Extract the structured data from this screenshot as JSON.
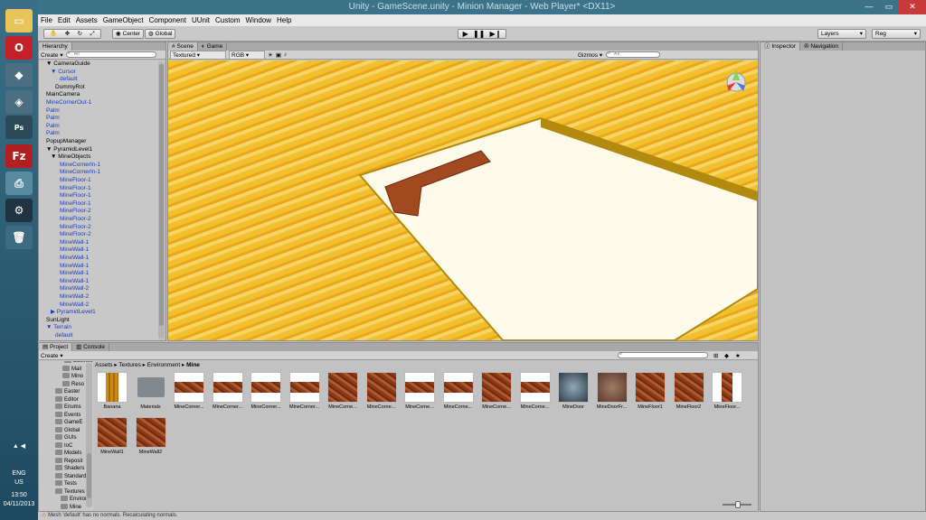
{
  "window": {
    "title": "Unity - GameScene.unity - Minion Manager - Web Player* <DX11>"
  },
  "menu": [
    "File",
    "Edit",
    "Assets",
    "GameObject",
    "Component",
    "UUnit",
    "Custom",
    "Window",
    "Help"
  ],
  "toolbar": {
    "center_label": "Center",
    "global_label": "Global",
    "layers_label": "Layers",
    "layout_label": "Reg"
  },
  "hierarchy": {
    "tab": "Hierarchy",
    "create": "Create",
    "search_placeholder": "All",
    "items": [
      {
        "text": "▼ CameraGuide",
        "indent": 0,
        "blue": false
      },
      {
        "text": "▼ Cursor",
        "indent": 1,
        "blue": true
      },
      {
        "text": "default",
        "indent": 3,
        "blue": true
      },
      {
        "text": "DummyRot",
        "indent": 2,
        "blue": false
      },
      {
        "text": "MainCamera",
        "indent": 0,
        "blue": false
      },
      {
        "text": "MineCornerOut-1",
        "indent": 0,
        "blue": true
      },
      {
        "text": "Palm",
        "indent": 0,
        "blue": true
      },
      {
        "text": "Palm",
        "indent": 0,
        "blue": true
      },
      {
        "text": "Palm",
        "indent": 0,
        "blue": true
      },
      {
        "text": "Palm",
        "indent": 0,
        "blue": true
      },
      {
        "text": "PopupManager",
        "indent": 0,
        "blue": false
      },
      {
        "text": "▼ PyramidLevel1",
        "indent": 0,
        "blue": false
      },
      {
        "text": "▼ MineObjects",
        "indent": 1,
        "blue": false
      },
      {
        "text": "MineCornerIn-1",
        "indent": 3,
        "blue": true
      },
      {
        "text": "MineCornerIn-1",
        "indent": 3,
        "blue": true
      },
      {
        "text": "MineFloor-1",
        "indent": 3,
        "blue": true
      },
      {
        "text": "MineFloor-1",
        "indent": 3,
        "blue": true
      },
      {
        "text": "MineFloor-1",
        "indent": 3,
        "blue": true
      },
      {
        "text": "MineFloor-1",
        "indent": 3,
        "blue": true
      },
      {
        "text": "MineFloor-2",
        "indent": 3,
        "blue": true
      },
      {
        "text": "MineFloor-2",
        "indent": 3,
        "blue": true
      },
      {
        "text": "MineFloor-2",
        "indent": 3,
        "blue": true
      },
      {
        "text": "MineFloor-2",
        "indent": 3,
        "blue": true
      },
      {
        "text": "MineWall-1",
        "indent": 3,
        "blue": true
      },
      {
        "text": "MineWall-1",
        "indent": 3,
        "blue": true
      },
      {
        "text": "MineWall-1",
        "indent": 3,
        "blue": true
      },
      {
        "text": "MineWall-1",
        "indent": 3,
        "blue": true
      },
      {
        "text": "MineWall-1",
        "indent": 3,
        "blue": true
      },
      {
        "text": "MineWall-1",
        "indent": 3,
        "blue": true
      },
      {
        "text": "MineWall-2",
        "indent": 3,
        "blue": true
      },
      {
        "text": "MineWall-2",
        "indent": 3,
        "blue": true
      },
      {
        "text": "MineWall-2",
        "indent": 3,
        "blue": true
      },
      {
        "text": "▶ PyramidLevel1",
        "indent": 1,
        "blue": true
      },
      {
        "text": "SunLight",
        "indent": 0,
        "blue": false
      },
      {
        "text": "▼ Terrain",
        "indent": 0,
        "blue": true
      },
      {
        "text": "default",
        "indent": 2,
        "blue": true
      },
      {
        "text": "Water",
        "indent": 0,
        "blue": false
      }
    ]
  },
  "scene": {
    "tab_scene": "Scene",
    "tab_game": "Game",
    "shading": "Textured",
    "render": "RGB",
    "gizmos": "Gizmos ▾",
    "search_placeholder": "All"
  },
  "inspector": {
    "tab_inspector": "Inspector",
    "tab_navigation": "Navigation"
  },
  "project": {
    "tab_project": "Project",
    "tab_console": "Console",
    "create": "Create",
    "breadcrumb": [
      "Assets",
      "Textures",
      "Environment",
      "Mine"
    ],
    "tree": [
      "Busines",
      "Mail",
      "Mino",
      "Reso",
      "Easter",
      "Editor",
      "Enums",
      "Events",
      "GameE",
      "Global",
      "GUIs",
      "IoC",
      "Models",
      "Reposit",
      "Shaders",
      "Standard",
      "Tests",
      "Textures",
      "Enviror",
      "Mine"
    ],
    "assets": [
      {
        "name": "Banana",
        "kind": "banana"
      },
      {
        "name": "Materials",
        "kind": "folder"
      },
      {
        "name": "MineCorner...",
        "kind": "strip"
      },
      {
        "name": "MineCorner...",
        "kind": "strip"
      },
      {
        "name": "MineCorner...",
        "kind": "strip"
      },
      {
        "name": "MineCorner...",
        "kind": "strip"
      },
      {
        "name": "MineCorne...",
        "kind": "brick"
      },
      {
        "name": "MineCorne...",
        "kind": "brick"
      },
      {
        "name": "MineCorne...",
        "kind": "strip"
      },
      {
        "name": "MineCorne...",
        "kind": "strip"
      },
      {
        "name": "MineCorne...",
        "kind": "brick"
      },
      {
        "name": "MineCorne...",
        "kind": "strip"
      },
      {
        "name": "MineDoor",
        "kind": "door"
      },
      {
        "name": "MineDoorFr...",
        "kind": "stone"
      },
      {
        "name": "MineFloor1",
        "kind": "brick"
      },
      {
        "name": "MineFloor2",
        "kind": "brick"
      },
      {
        "name": "MineFloor...",
        "kind": "tall"
      },
      {
        "name": "MineWall1",
        "kind": "brick"
      },
      {
        "name": "MineWall2",
        "kind": "brick"
      }
    ]
  },
  "status": {
    "message": "Mesh 'default' has no normals. Recalculating normals."
  },
  "taskbar": {
    "lang1": "ENG",
    "lang2": "US",
    "time": "13:50",
    "date": "04/11/2013"
  }
}
